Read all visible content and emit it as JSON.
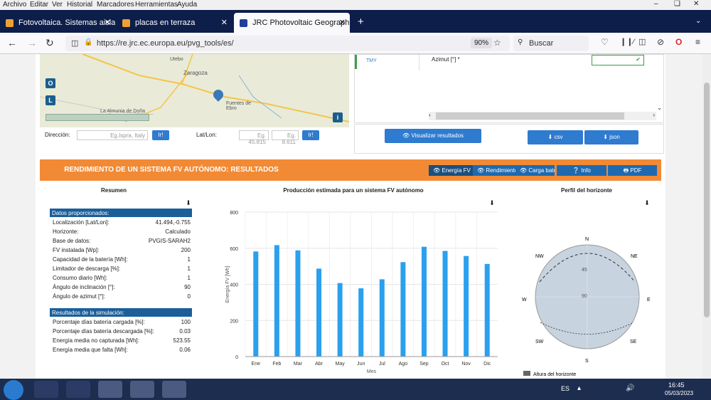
{
  "menu": [
    "Archivo",
    "Editar",
    "Ver",
    "Historial",
    "Marcadores",
    "Herramientas",
    "Ayuda"
  ],
  "tabs": [
    {
      "label": "Fotovoltaica. Sistemas aislado",
      "active": false
    },
    {
      "label": "placas en terraza",
      "active": false
    },
    {
      "label": "JRC Photovoltaic Geographical I",
      "active": true
    }
  ],
  "navbar": {
    "url": "https://re.jrc.ec.europa.eu/pvg_tools/es/",
    "zoom": "90%",
    "search_placeholder": "Buscar"
  },
  "map": {
    "labels": [
      "Utebo",
      "Zaragoza",
      "Fuentes de Ebro",
      "La Almunia de Doña Godina"
    ],
    "buttons": [
      "O",
      "L"
    ],
    "info": "i"
  },
  "address": {
    "label": "Dirección:",
    "placeholder": "Eg.Ispra, Italy",
    "go": "Ir!",
    "latlon_label": "Lat/Lon:",
    "lat_placeholder": "Eg. 45.815",
    "lon_placeholder": "Eg. 8.611",
    "go2": "Ir!"
  },
  "tmy": {
    "label": "TMY",
    "field": "Azimut [°] *"
  },
  "actions": {
    "visualize": "Visualizar resultados",
    "csv": "csv",
    "json": "json"
  },
  "results": {
    "title": "RENDIMIENTO DE UN SISTEMA FV AUTÓNOMO: RESULTADOS",
    "buttons": [
      "Energía FV",
      "Rendimiento",
      "Carga batería",
      "Info",
      "PDF"
    ]
  },
  "summary": {
    "title": "Resumen",
    "input_header": "Datos proporcionados:",
    "inputs": [
      {
        "k": "Localización [Lat/Lon]:",
        "v": "41.494,-0.755"
      },
      {
        "k": "Horizonte:",
        "v": "Calculado"
      },
      {
        "k": "Base de datos:",
        "v": "PVGIS-SARAH2"
      },
      {
        "k": "FV instalada [Wp]:",
        "v": "200"
      },
      {
        "k": "Capacidad de la batería [Wh]:",
        "v": "1"
      },
      {
        "k": "Limitador de descarga [%]:",
        "v": "1"
      },
      {
        "k": "Consumo diario [Wh]:",
        "v": "1"
      },
      {
        "k": "Ángulo de inclinación [°]:",
        "v": "90"
      },
      {
        "k": "Ángulo de azimut [°]:",
        "v": "0"
      }
    ],
    "results_header": "Resultados de la simulación:",
    "results": [
      {
        "k": "Porcentaje días batería cargada [%]:",
        "v": "100"
      },
      {
        "k": "Porcentaje días batería descargada [%]:",
        "v": "0.03"
      },
      {
        "k": "Energía media no capturada [Wh]:",
        "v": "523.55"
      },
      {
        "k": "Energía media que falta [Wh]:",
        "v": "0.06"
      }
    ]
  },
  "chart_data": {
    "type": "bar",
    "title": "Producción estimada para un sistema FV autónomo",
    "xlabel": "Mes",
    "ylabel": "Energía FV [Wh]",
    "ylim": [
      0,
      800
    ],
    "yticks": [
      0,
      200,
      400,
      600,
      800
    ],
    "categories": [
      "Ene",
      "Feb",
      "Mar",
      "Abr",
      "May",
      "Jun",
      "Jul",
      "Ago",
      "Sep",
      "Oct",
      "Nov",
      "Dic"
    ],
    "values": [
      582,
      617,
      588,
      487,
      407,
      378,
      428,
      523,
      608,
      585,
      557,
      513
    ],
    "color": "#2aa0ee"
  },
  "horizon": {
    "title": "Perfil del horizonte",
    "directions": [
      "N",
      "NE",
      "E",
      "SE",
      "S",
      "SW",
      "W",
      "NW"
    ],
    "rings": [
      "45",
      "90"
    ],
    "legend": "Altura del horizonte"
  },
  "taskbar": {
    "lang": "ES",
    "time": "16:45",
    "date": "05/03/2023"
  }
}
